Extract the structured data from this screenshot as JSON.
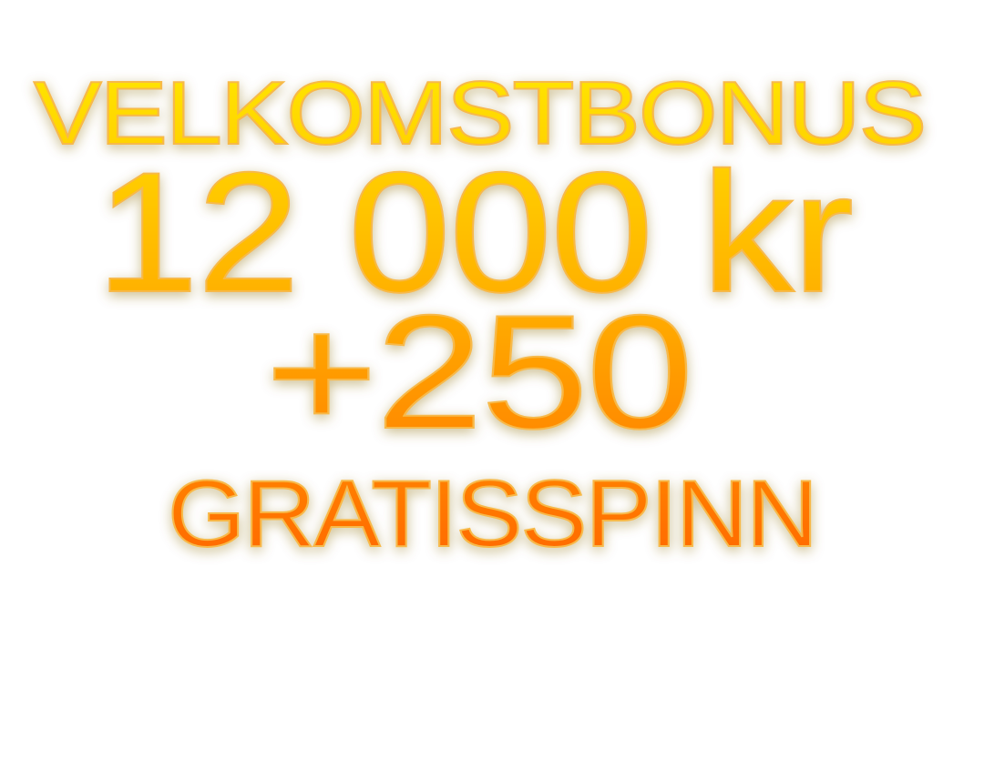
{
  "promo": {
    "headline": "VELKOMSTBONUS",
    "bonus_amount": "12 000 kr",
    "spins_count": "+250",
    "spins_label": "GRATISSPINN"
  },
  "colors": {
    "gradient_top": "#ffe600",
    "gradient_mid": "#ffb300",
    "gradient_bottom": "#ff6a00",
    "stroke": "#f7b94a",
    "background": "#ffffff"
  }
}
